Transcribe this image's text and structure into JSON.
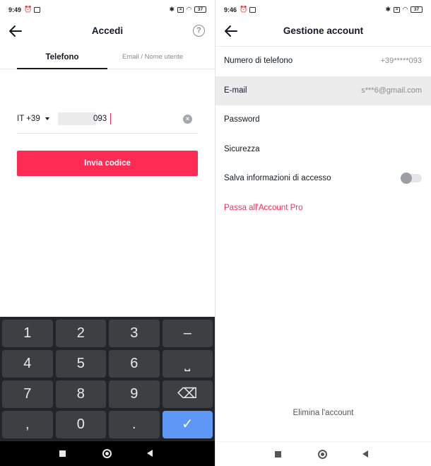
{
  "left": {
    "status": {
      "time": "9:49",
      "battery": "37"
    },
    "header": {
      "title": "Accedi",
      "help": "?"
    },
    "tabs": [
      {
        "label": "Telefono"
      },
      {
        "label": "Email / Nome utente"
      }
    ],
    "phone": {
      "country_code": "IT +39",
      "number_visible": "093",
      "clear": "×"
    },
    "send_button": "Invia codice",
    "keyboard": {
      "rows": [
        [
          "1",
          "2",
          "3",
          "–"
        ],
        [
          "4",
          "5",
          "6",
          "⎵"
        ],
        [
          "7",
          "8",
          "9",
          "⌫"
        ],
        [
          ",",
          "0",
          ".",
          "✓"
        ]
      ]
    }
  },
  "right": {
    "status": {
      "time": "9:46",
      "battery": "37"
    },
    "header": {
      "title": "Gestione account"
    },
    "items": [
      {
        "label": "Numero di telefono",
        "value": "+39*****093"
      },
      {
        "label": "E-mail",
        "value": "s***6@gmail.com"
      },
      {
        "label": "Password",
        "value": ""
      },
      {
        "label": "Sicurezza",
        "value": ""
      },
      {
        "label": "Salva informazioni di accesso",
        "value": ""
      },
      {
        "label": "Passa all'Account Pro",
        "value": ""
      }
    ],
    "delete_account": "Elimina l'account"
  },
  "colors": {
    "accent": "#fe2c55",
    "keyboard_bg": "#212429",
    "key_bg": "#3c4043",
    "enter_key": "#5e97f6"
  },
  "icons": [
    "back-arrow-icon",
    "help-icon",
    "clear-icon",
    "chevron-down-icon",
    "backspace-icon",
    "check-icon",
    "alarm-icon",
    "bluetooth-icon",
    "wifi-icon",
    "battery-icon"
  ]
}
